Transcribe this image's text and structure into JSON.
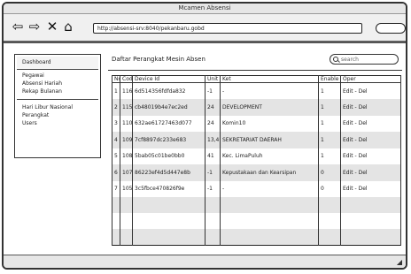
{
  "window": {
    "title": "Mcamen Absensi"
  },
  "browser": {
    "url": "http://absensi-srv:8040/pekanbaru.gobd",
    "icons": [
      "back-arrow-icon",
      "forward-arrow-icon",
      "close-icon",
      "home-icon"
    ]
  },
  "sidebar": {
    "dashboard": "Dashboard",
    "group1": [
      "Pegawai",
      "Absensi Hariah",
      "Rekap Bulanan"
    ],
    "group2": [
      "Hari Libur Nasional",
      "Perangkat",
      "Users"
    ]
  },
  "main": {
    "title": "Daftar Perangkat Mesin Absen",
    "search_placeholder": "search",
    "columns": [
      "No",
      "Code",
      "Device Id",
      "Unit",
      "Ket",
      "Enable",
      "Oper"
    ],
    "rows": [
      [
        "1",
        "116",
        "6d514356fdfda832",
        "-1",
        "-",
        "1",
        "Edit - Del"
      ],
      [
        "2",
        "115",
        "cb48019b4e7ec2ed",
        "24",
        "DEVELOPMENT",
        "1",
        "Edit - Del"
      ],
      [
        "3",
        "110",
        "632ae61727463d077",
        "24",
        "Komin10",
        "1",
        "Edit - Del"
      ],
      [
        "4",
        "109",
        "7cf8897dc233e683",
        "13,4",
        "SEKRETARIAT DAERAH",
        "1",
        "Edit - Del"
      ],
      [
        "5",
        "108",
        "5bab05c01be0bb0",
        "41",
        "Kec. LimaPuluh",
        "1",
        "Edit - Del"
      ],
      [
        "6",
        "107",
        "86223ef4d5d447e8b",
        "-1",
        "Kepustakaan dan Kearsipan",
        "0",
        "Edit - Del"
      ],
      [
        "7",
        "105",
        "3c5fbce470826f9e",
        "-1",
        "-",
        "0",
        "Edit - Del"
      ]
    ],
    "empty_rows": 3
  }
}
